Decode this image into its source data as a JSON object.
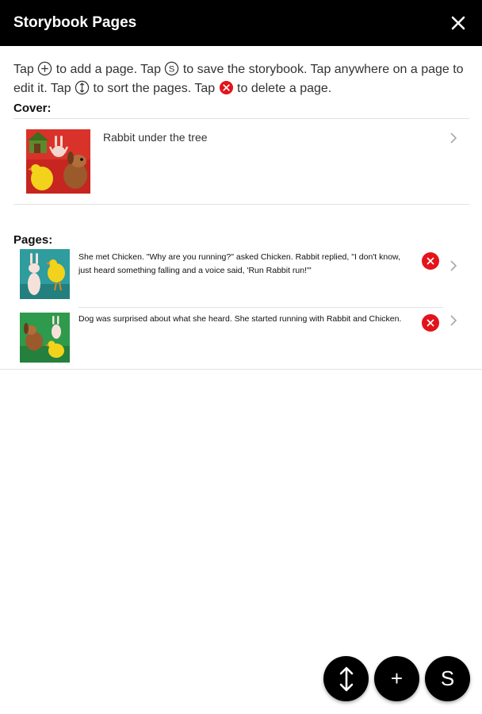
{
  "header": {
    "title": "Storybook Pages",
    "close_icon": "close-icon"
  },
  "instructions": {
    "part1": "Tap ",
    "part2": " to add a page. Tap ",
    "part3": " to save the storybook. Tap anywhere on a page to edit it. Tap ",
    "part4": " to sort the pages. Tap ",
    "part5": " to delete a page."
  },
  "cover": {
    "label": "Cover:",
    "title": "Rabbit under the tree"
  },
  "pages": {
    "label": "Pages:",
    "items": [
      {
        "line1": "She met Chicken. \"Why are you running?\" asked Chicken. Rabbit replied, \"I don't know,",
        "line2": "just heard something falling and a voice said, 'Run Rabbit run!'\""
      },
      {
        "line1": "Dog was surprised about what she heard. She started running with Rabbit and Chicken.",
        "line2": ""
      }
    ]
  },
  "fabs": {
    "sort_icon": "sort-arrows-icon",
    "add_label": "+",
    "save_label": "S"
  },
  "colors": {
    "topbar": "#000000",
    "delete": "#e4131a",
    "fab": "#000000"
  }
}
